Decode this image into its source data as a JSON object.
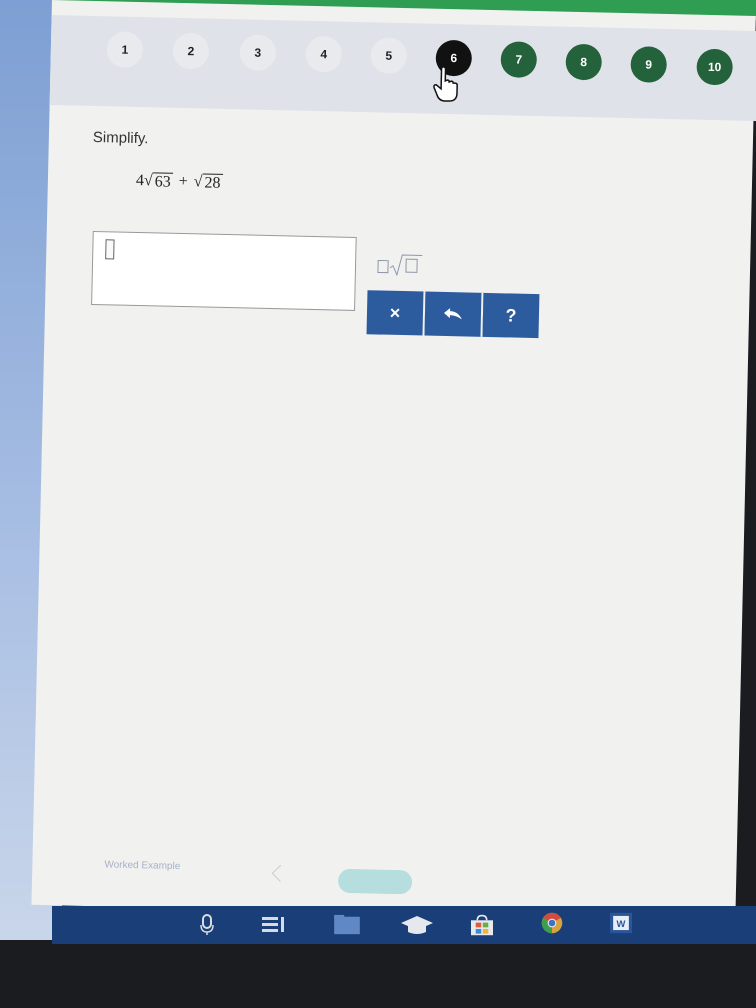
{
  "question_nav": {
    "items": [
      {
        "label": "1",
        "state": "done"
      },
      {
        "label": "2",
        "state": "done"
      },
      {
        "label": "3",
        "state": "done"
      },
      {
        "label": "4",
        "state": "done"
      },
      {
        "label": "5",
        "state": "done"
      },
      {
        "label": "6",
        "state": "current"
      },
      {
        "label": "7",
        "state": "todo"
      },
      {
        "label": "8",
        "state": "todo"
      },
      {
        "label": "9",
        "state": "todo"
      },
      {
        "label": "10",
        "state": "todo"
      }
    ]
  },
  "problem": {
    "instruction": "Simplify.",
    "coef": "4",
    "rad1": "63",
    "plus": "+",
    "rad2": "28"
  },
  "answer": {
    "value": ""
  },
  "toolbar": {
    "clear": "×",
    "help": "?"
  },
  "footer": {
    "worked_example": "Worked Example"
  },
  "colors": {
    "accent_blue": "#2d5c9e",
    "nav_todo_green": "#23623a",
    "nav_current": "#111111",
    "brand_green": "#2f9e52",
    "taskbar": "#1a3e78"
  },
  "taskbar_icons": [
    "microphone-icon",
    "task-view-icon",
    "file-explorer-icon",
    "graduation-cap-icon",
    "store-icon",
    "chrome-icon",
    "word-icon"
  ]
}
